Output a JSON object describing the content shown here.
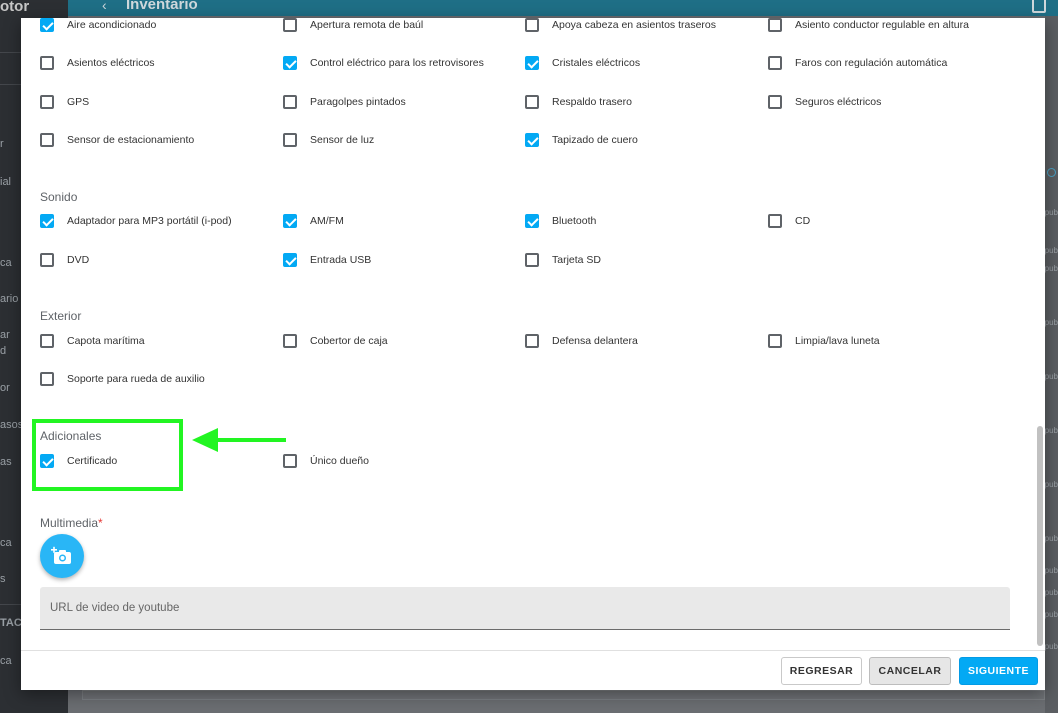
{
  "background": {
    "brand": "otor",
    "topbar_title": "Inventario",
    "sidebar_items": [
      "r",
      "ial",
      "ca",
      "ario",
      "ar",
      "d",
      "or",
      "asos",
      "as",
      "ca",
      "s",
      "TAC",
      "ca"
    ],
    "right_labels": [
      "pub",
      "pub",
      "pub",
      "pub",
      "pub",
      "pub",
      "pub",
      "pub",
      "pub",
      "pub",
      "pub",
      "pub"
    ]
  },
  "sections": {
    "confort": {
      "rows": [
        [
          {
            "label": "Aire acondicionado",
            "checked": true
          },
          {
            "label": "Apertura remota de baúl",
            "checked": false
          },
          {
            "label": "Apoya cabeza en asientos traseros",
            "checked": false
          },
          {
            "label": "Asiento conductor regulable en altura",
            "checked": false
          }
        ],
        [
          {
            "label": "Asientos eléctricos",
            "checked": false
          },
          {
            "label": "Control eléctrico para los retrovisores",
            "checked": true
          },
          {
            "label": "Cristales eléctricos",
            "checked": true
          },
          {
            "label": "Faros con regulación automática",
            "checked": false
          }
        ],
        [
          {
            "label": "GPS",
            "checked": false
          },
          {
            "label": "Paragolpes pintados",
            "checked": false
          },
          {
            "label": "Respaldo trasero",
            "checked": false
          },
          {
            "label": "Seguros eléctricos",
            "checked": false
          }
        ],
        [
          {
            "label": "Sensor de estacionamiento",
            "checked": false
          },
          {
            "label": "Sensor de luz",
            "checked": false
          },
          {
            "label": "Tapizado de cuero",
            "checked": true
          }
        ]
      ]
    },
    "sonido": {
      "title": "Sonido",
      "rows": [
        [
          {
            "label": "Adaptador para MP3 portátil (i-pod)",
            "checked": true
          },
          {
            "label": "AM/FM",
            "checked": true
          },
          {
            "label": "Bluetooth",
            "checked": true
          },
          {
            "label": "CD",
            "checked": false
          }
        ],
        [
          {
            "label": "DVD",
            "checked": false
          },
          {
            "label": "Entrada USB",
            "checked": true
          },
          {
            "label": "Tarjeta SD",
            "checked": false
          }
        ]
      ]
    },
    "exterior": {
      "title": "Exterior",
      "rows": [
        [
          {
            "label": "Capota marítima",
            "checked": false
          },
          {
            "label": "Cobertor de caja",
            "checked": false
          },
          {
            "label": "Defensa delantera",
            "checked": false
          },
          {
            "label": "Limpia/lava luneta",
            "checked": false
          }
        ],
        [
          {
            "label": "Soporte para rueda de auxilio",
            "checked": false
          }
        ]
      ]
    },
    "adicionales": {
      "title": "Adicionales",
      "rows": [
        [
          {
            "label": "Certificado",
            "checked": true
          },
          {
            "label": "Único dueño",
            "checked": false
          }
        ]
      ]
    }
  },
  "multimedia": {
    "title": "Multimedia",
    "required_mark": "*",
    "url_placeholder": "URL de video de youtube",
    "url_value": ""
  },
  "footer": {
    "back_label": "REGRESAR",
    "cancel_label": "CANCELAR",
    "next_label": "SIGUIENTE"
  },
  "colors": {
    "accent": "#03a9f4",
    "annotation": "#22f522",
    "required": "#e53935"
  }
}
